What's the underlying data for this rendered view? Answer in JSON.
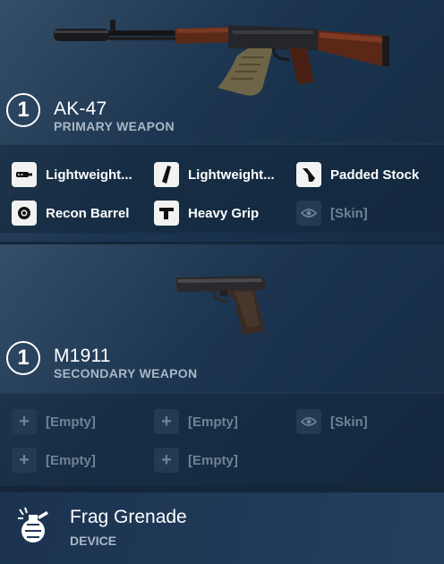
{
  "primary": {
    "slot_number": "1",
    "name": "AK-47",
    "type_label": "PRIMARY WEAPON",
    "image_icon": "ak47-rifle-icon",
    "attachments": [
      {
        "label": "Lightweight...",
        "icon": "suppressor-icon",
        "empty": false
      },
      {
        "label": "Lightweight...",
        "icon": "magazine-icon",
        "empty": false
      },
      {
        "label": "Padded Stock",
        "icon": "stock-icon",
        "empty": false
      },
      {
        "label": "Recon Barrel",
        "icon": "barrel-icon",
        "empty": false
      },
      {
        "label": "Heavy Grip",
        "icon": "grip-icon",
        "empty": false
      },
      {
        "label": "[Skin]",
        "icon": "eye-icon",
        "empty": true
      }
    ]
  },
  "secondary": {
    "slot_number": "1",
    "name": "M1911",
    "type_label": "SECONDARY WEAPON",
    "image_icon": "m1911-pistol-icon",
    "attachments": [
      {
        "label": "[Empty]",
        "icon": "plus-icon",
        "empty": true
      },
      {
        "label": "[Empty]",
        "icon": "plus-icon",
        "empty": true
      },
      {
        "label": "[Skin]",
        "icon": "eye-icon",
        "empty": true
      },
      {
        "label": "[Empty]",
        "icon": "plus-icon",
        "empty": true
      },
      {
        "label": "[Empty]",
        "icon": "plus-icon",
        "empty": true
      }
    ]
  },
  "device": {
    "name": "Frag Grenade",
    "type_label": "DEVICE",
    "icon": "frag-grenade-icon"
  },
  "colors": {
    "panel": "#1c3550",
    "text_secondary": "#a9b8c6",
    "text_dim": "#6f8397",
    "icon_bg": "#f2f2f2"
  }
}
